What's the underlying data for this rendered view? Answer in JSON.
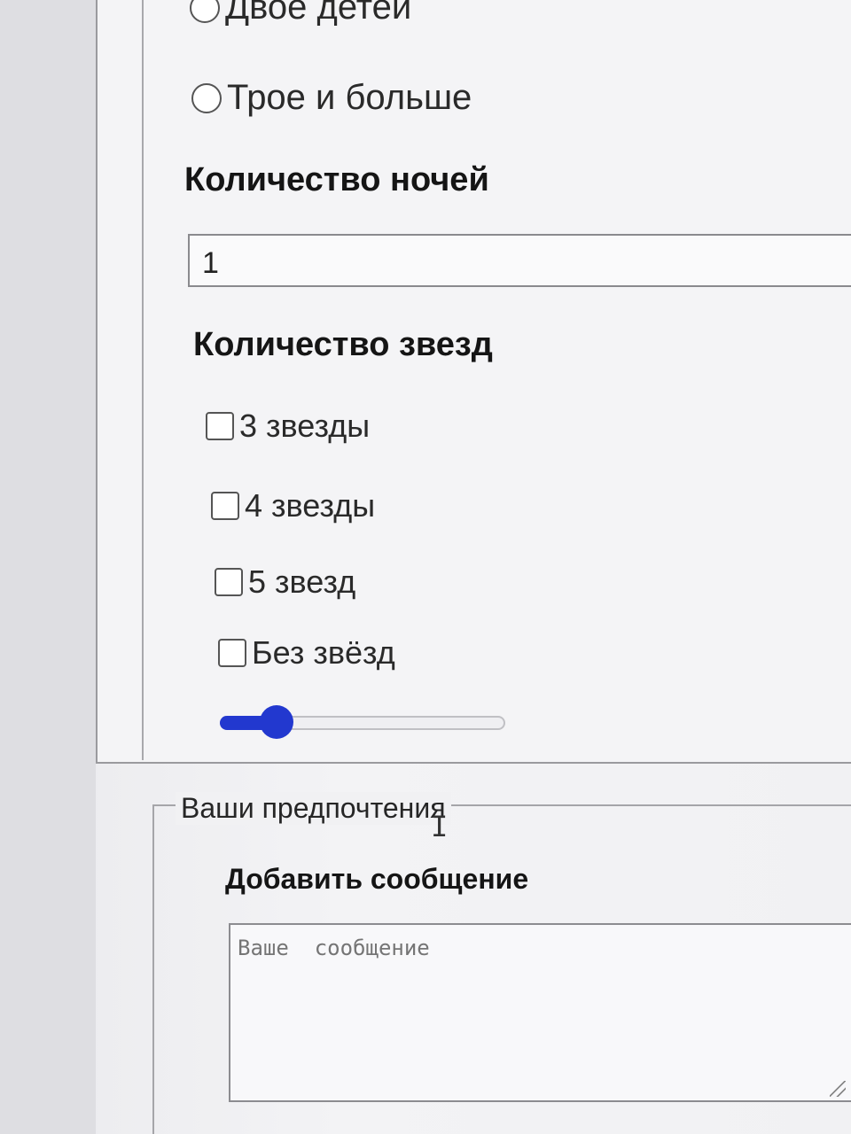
{
  "children_group": {
    "options": [
      {
        "label": "Двое детей",
        "checked": false
      },
      {
        "label": "Трое и больше",
        "checked": false
      }
    ]
  },
  "nights": {
    "label": "Количество ночей",
    "value": "1"
  },
  "stars": {
    "label": "Количество звезд",
    "options": [
      {
        "label": "3 звезды",
        "checked": false
      },
      {
        "label": "4 звезды",
        "checked": false
      },
      {
        "label": "5 звезд",
        "checked": false
      },
      {
        "label": "Без звёзд",
        "checked": false
      }
    ],
    "slider_level": 0.2
  },
  "preferences": {
    "legend": "Ваши предпочтения",
    "message_label": "Добавить сообщение",
    "message_placeholder": "Ваше  сообщение",
    "message_value": ""
  },
  "colors": {
    "slider_accent": "#2238cf"
  },
  "icons": {
    "cursor": "text-cursor-icon"
  }
}
